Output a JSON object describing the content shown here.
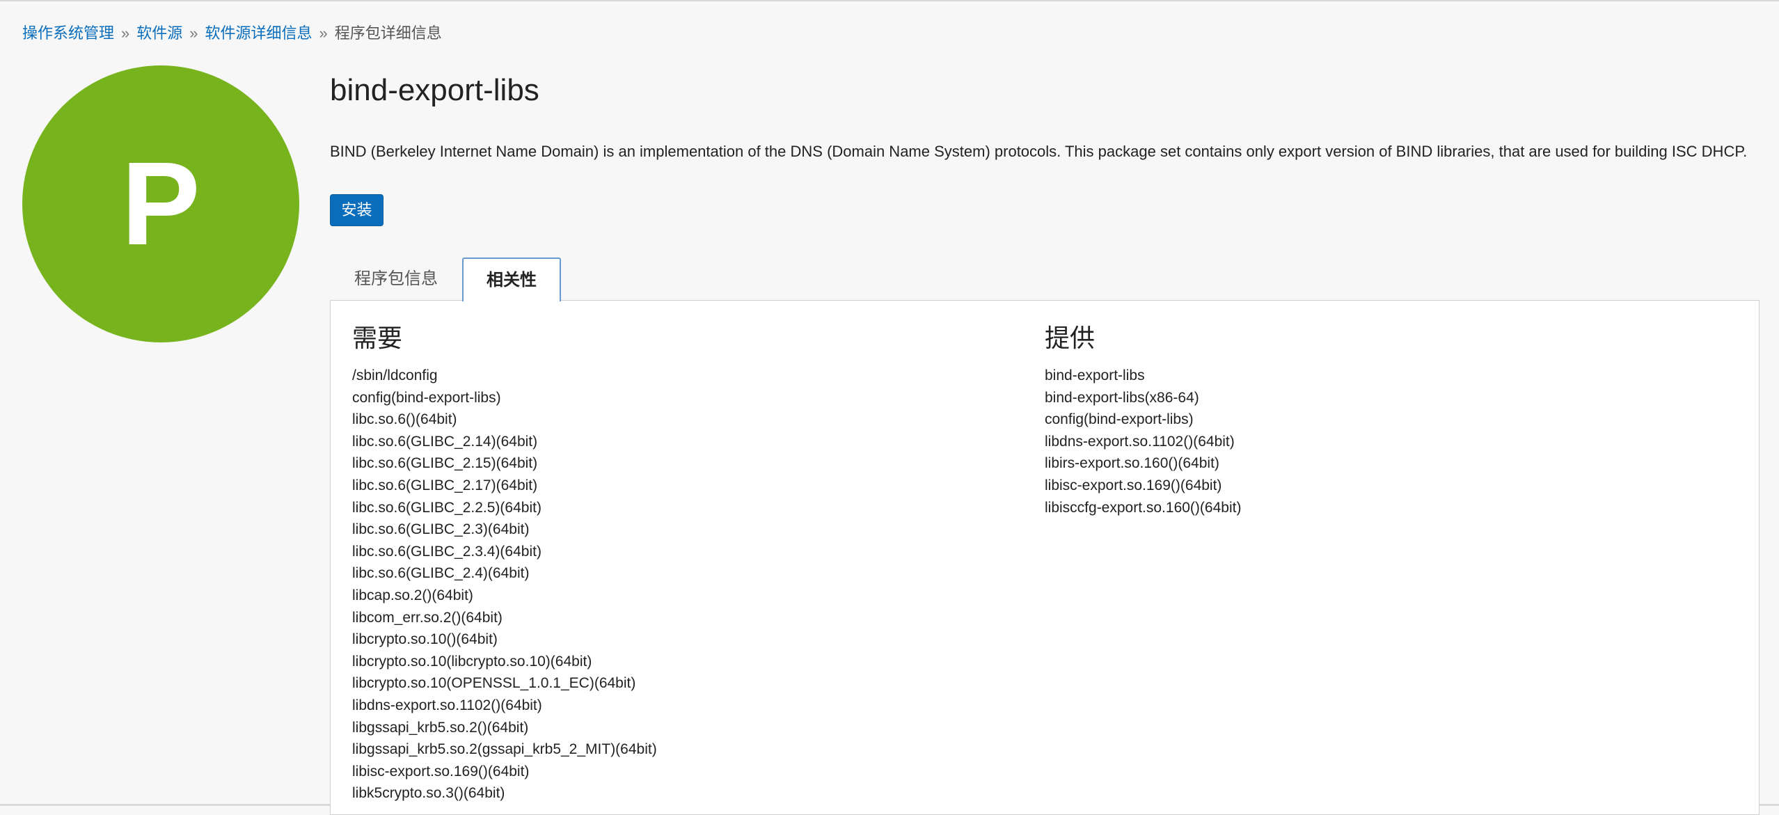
{
  "breadcrumb": {
    "items": [
      "操作系统管理",
      "软件源",
      "软件源详细信息"
    ],
    "separator": "»",
    "current": "程序包详细信息"
  },
  "package": {
    "avatar_letter": "P",
    "avatar_color": "#76b31c",
    "name": "bind-export-libs",
    "description": "BIND (Berkeley Internet Name Domain) is an implementation of the DNS (Domain Name System) protocols. This package set contains only export version of BIND libraries, that are used for building ISC DHCP.",
    "install_label": "安装"
  },
  "tabs": {
    "info": "程序包信息",
    "deps": "相关性",
    "active": "相关性"
  },
  "requires": {
    "heading": "需要",
    "items": [
      "/sbin/ldconfig",
      "config(bind-export-libs)",
      "libc.so.6()(64bit)",
      "libc.so.6(GLIBC_2.14)(64bit)",
      "libc.so.6(GLIBC_2.15)(64bit)",
      "libc.so.6(GLIBC_2.17)(64bit)",
      "libc.so.6(GLIBC_2.2.5)(64bit)",
      "libc.so.6(GLIBC_2.3)(64bit)",
      "libc.so.6(GLIBC_2.3.4)(64bit)",
      "libc.so.6(GLIBC_2.4)(64bit)",
      "libcap.so.2()(64bit)",
      "libcom_err.so.2()(64bit)",
      "libcrypto.so.10()(64bit)",
      "libcrypto.so.10(libcrypto.so.10)(64bit)",
      "libcrypto.so.10(OPENSSL_1.0.1_EC)(64bit)",
      "libdns-export.so.1102()(64bit)",
      "libgssapi_krb5.so.2()(64bit)",
      "libgssapi_krb5.so.2(gssapi_krb5_2_MIT)(64bit)",
      "libisc-export.so.169()(64bit)",
      "libk5crypto.so.3()(64bit)"
    ]
  },
  "provides": {
    "heading": "提供",
    "items": [
      "bind-export-libs",
      "bind-export-libs(x86-64)",
      "config(bind-export-libs)",
      "libdns-export.so.1102()(64bit)",
      "libirs-export.so.160()(64bit)",
      "libisc-export.so.169()(64bit)",
      "libisccfg-export.so.160()(64bit)"
    ]
  }
}
